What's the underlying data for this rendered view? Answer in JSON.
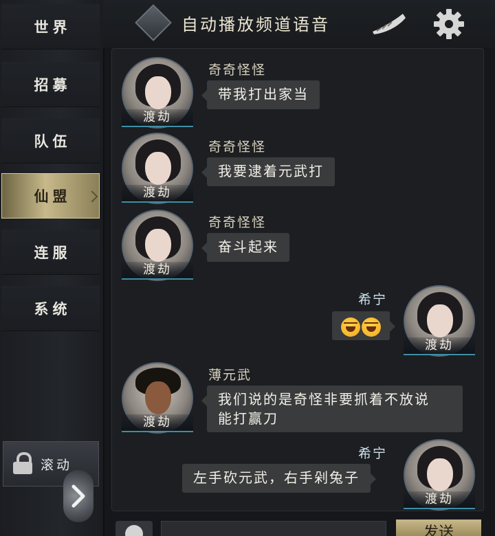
{
  "sidebar": {
    "tabs": [
      {
        "label": "世界",
        "active": false
      },
      {
        "label": "招募",
        "active": false
      },
      {
        "label": "队伍",
        "active": false
      },
      {
        "label": "仙盟",
        "active": true
      },
      {
        "label": "连服",
        "active": false
      },
      {
        "label": "系统",
        "active": false
      }
    ],
    "scroll_label": "滚动"
  },
  "header": {
    "title": "自动播放频道语音"
  },
  "messages": [
    {
      "sender": "奇奇怪怪",
      "title": "渡劫",
      "text": "带我打出家当",
      "side": "left"
    },
    {
      "sender": "奇奇怪怪",
      "title": "渡劫",
      "text": "我要逮着元武打",
      "side": "left"
    },
    {
      "sender": "奇奇怪怪",
      "title": "渡劫",
      "text": "奋斗起来",
      "side": "left"
    },
    {
      "sender": "希宁",
      "title": "渡劫",
      "text": "",
      "side": "right",
      "emoji_count": 2
    },
    {
      "sender": "薄元武",
      "title": "渡劫",
      "text_line1": "我们说的是奇怪非要抓着不放说",
      "text_line2": "能打赢刀",
      "side": "left"
    },
    {
      "sender": "希宁",
      "title": "渡劫",
      "text": "左手砍元武，右手剁兔子",
      "side": "right"
    }
  ],
  "bottom": {
    "send_label": "发送"
  },
  "colors": {
    "accent_gold": "#c7b98a",
    "bubble": "#3a3b3d",
    "title_underline": "#3e8fa5"
  }
}
